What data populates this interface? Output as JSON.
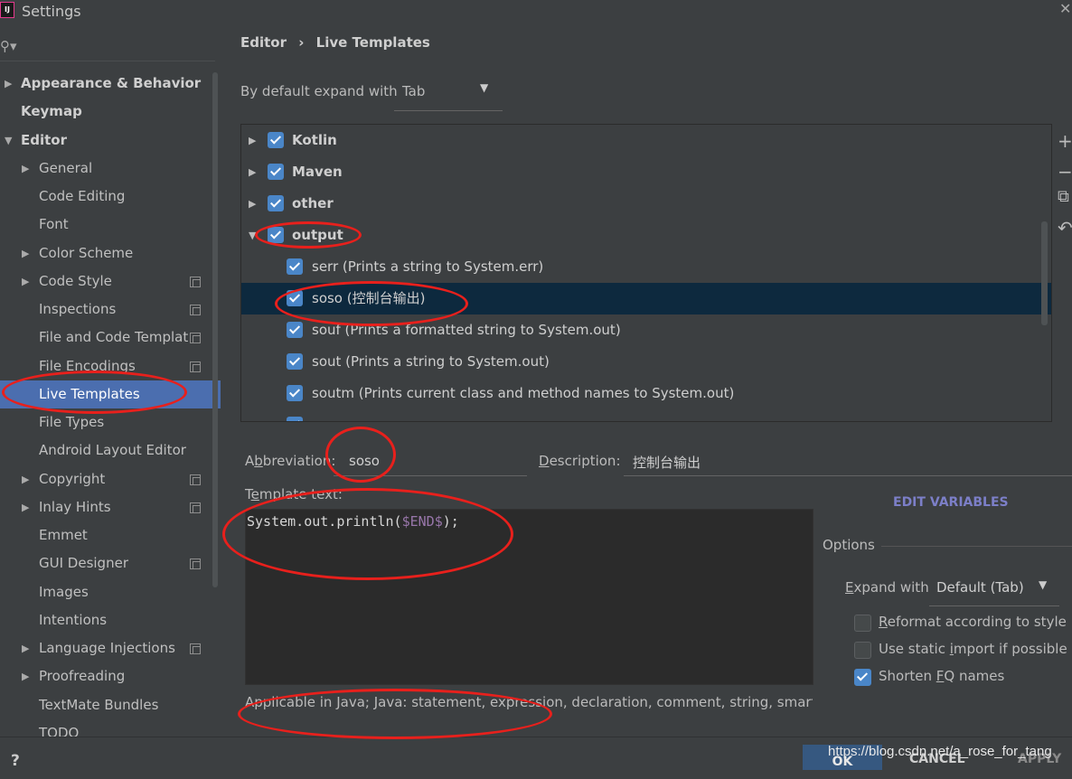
{
  "window": {
    "title": "Settings",
    "app_icon": "IJ"
  },
  "sidebar": {
    "items": [
      {
        "label": "Appearance & Behavior",
        "arrow": "▶",
        "bold": true
      },
      {
        "label": "Keymap",
        "bold": true
      },
      {
        "label": "Editor",
        "arrow": "▼",
        "bold": true
      },
      {
        "label": "General",
        "arrow": "▶"
      },
      {
        "label": "Code Editing"
      },
      {
        "label": "Font"
      },
      {
        "label": "Color Scheme",
        "arrow": "▶"
      },
      {
        "label": "Code Style",
        "arrow": "▶",
        "copy": true
      },
      {
        "label": "Inspections",
        "copy": true
      },
      {
        "label": "File and Code Templat",
        "copy": true
      },
      {
        "label": "File Encodings",
        "copy": true
      },
      {
        "label": "Live Templates",
        "selected": true
      },
      {
        "label": "File Types"
      },
      {
        "label": "Android Layout Editor"
      },
      {
        "label": "Copyright",
        "arrow": "▶",
        "copy": true
      },
      {
        "label": "Inlay Hints",
        "arrow": "▶",
        "copy": true
      },
      {
        "label": "Emmet"
      },
      {
        "label": "GUI Designer",
        "copy": true
      },
      {
        "label": "Images"
      },
      {
        "label": "Intentions"
      },
      {
        "label": "Language Injections",
        "arrow": "▶",
        "copy": true
      },
      {
        "label": "Proofreading",
        "arrow": "▶"
      },
      {
        "label": "TextMate Bundles"
      },
      {
        "label": "TODO"
      }
    ]
  },
  "breadcrumb": {
    "parent": "Editor",
    "separator": "›",
    "current": "Live Templates"
  },
  "expand_default": {
    "label": "By default expand with",
    "value": "Tab"
  },
  "templates": [
    {
      "label": "Kotlin",
      "group": true,
      "arrow": "▶"
    },
    {
      "label": "Maven",
      "group": true,
      "arrow": "▶"
    },
    {
      "label": "other",
      "group": true,
      "arrow": "▶"
    },
    {
      "label": "output",
      "group": true,
      "arrow": "▼"
    },
    {
      "label": "serr (Prints a string to System.err)"
    },
    {
      "label": "soso (控制台输出)",
      "selected": true
    },
    {
      "label": "souf (Prints a formatted string to System.out)"
    },
    {
      "label": "sout (Prints a string to System.out)"
    },
    {
      "label": "soutm (Prints current class and method names to System.out)"
    },
    {
      "label": ""
    }
  ],
  "tools": {
    "add": "+",
    "remove": "−",
    "copy": "⧉",
    "revert": "↶"
  },
  "editor": {
    "abbr_label_pre": "A",
    "abbr_label_ul": "b",
    "abbr_label_post": "breviation:",
    "abbreviation": "soso",
    "desc_label_ul": "D",
    "desc_label_post": "escription:",
    "description": "控制台输出",
    "template_label_pre": "T",
    "template_label_ul": "e",
    "template_label_post": "mplate text:",
    "code_prefix": "System.out.println(",
    "code_var": "$END$",
    "code_suffix": ");",
    "applicable": "Applicable in Java; Java: statement, expression, declaration, comment, string, smart type completion...",
    "edit_variables": "EDIT VARIABLES"
  },
  "options": {
    "title": "Options",
    "expand_label_ul": "E",
    "expand_label_post": "xpand with",
    "expand_value": "Default (Tab)",
    "checkboxes": [
      {
        "pre": "",
        "ul": "R",
        "post": "eformat according to style",
        "checked": false
      },
      {
        "pre": "Use static ",
        "ul": "i",
        "post": "mport if possible",
        "checked": false
      },
      {
        "pre": "Shorten ",
        "ul": "F",
        "post": "Q names",
        "checked": true
      }
    ]
  },
  "buttons": {
    "ok": "OK",
    "cancel": "CANCEL",
    "apply": "APPLY",
    "help": "?"
  },
  "watermark": "https://blog.csdn.net/a_rose_for_tang",
  "colors": {
    "background": "#3c3f41",
    "selection": "#4b6eaf",
    "tree_selection": "#0d293e",
    "checkbox": "#4a86c8",
    "annotation": "#e8201c"
  }
}
